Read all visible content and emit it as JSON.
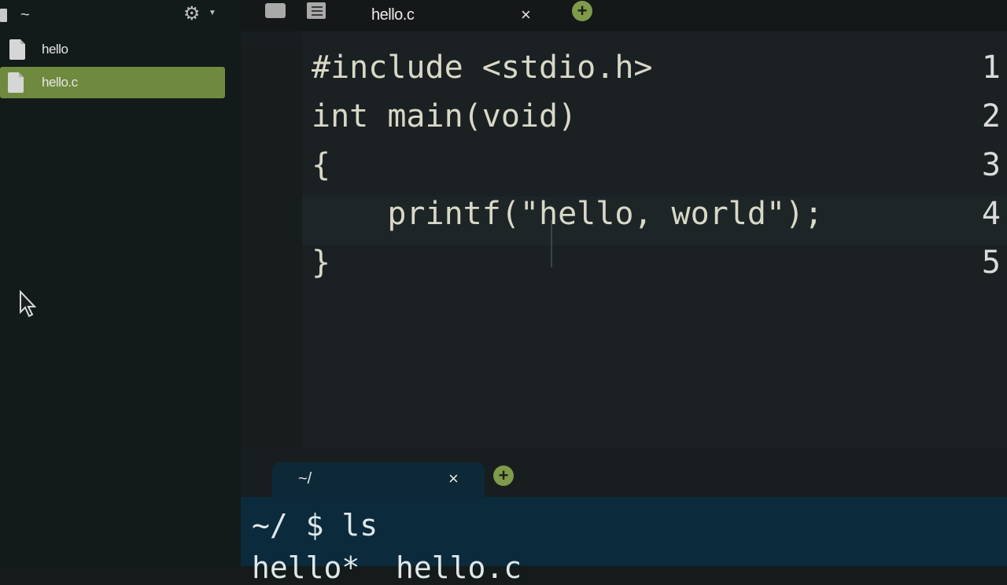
{
  "sidebar": {
    "home_label": "~",
    "files": [
      {
        "name": "hello"
      },
      {
        "name": "hello.c"
      }
    ]
  },
  "editor": {
    "tab_label": "hello.c",
    "close_symbol": "×",
    "add_symbol": "+",
    "lines": [
      {
        "number": "1",
        "text": "#include <stdio.h>"
      },
      {
        "number": "2",
        "text": "int main(void)"
      },
      {
        "number": "3",
        "text": "{"
      },
      {
        "number": "4",
        "text": "    printf(\"hello, world\");"
      },
      {
        "number": "5",
        "text": "}"
      }
    ]
  },
  "terminal": {
    "tab_label": "~/",
    "close_symbol": "×",
    "add_symbol": "+",
    "lines": [
      "~/ $ ls",
      "hello*  hello.c"
    ]
  },
  "colors": {
    "selected_file_bg": "#6f8a3f",
    "add_button": "#7f9a4a",
    "terminal_bg": "#0b2a3b"
  }
}
